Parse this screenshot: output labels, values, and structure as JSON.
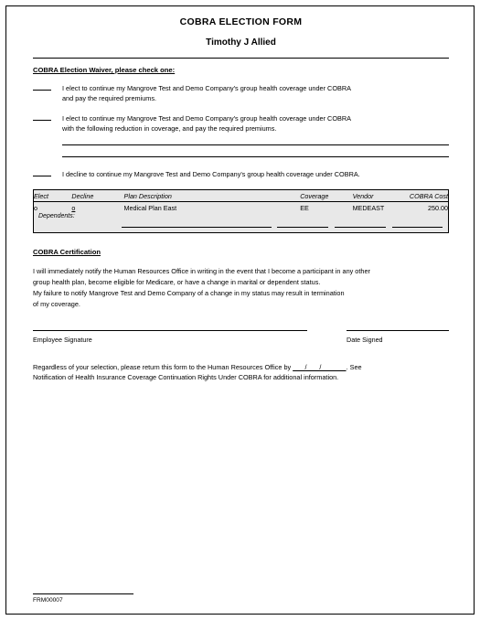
{
  "document": {
    "title": "COBRA ELECTION FORM",
    "employee_name": "Timothy J Allied"
  },
  "waiver": {
    "heading": "COBRA Election Waiver, please check one:",
    "options": [
      {
        "blank": "",
        "line1": "I elect to continue my Mangrove Test and Demo Company's group health coverage under COBRA",
        "line2": "and pay the required premiums."
      },
      {
        "blank": "",
        "line1": "I elect to continue my Mangrove Test and Demo Company's group health coverage under COBRA",
        "line2": "with the following reduction in coverage, and pay the required premiums."
      }
    ],
    "decline_option": {
      "blank": "",
      "text": "I decline to continue my Mangrove Test and Demo Company's group health coverage under COBRA."
    }
  },
  "plan_table": {
    "headers": {
      "elect": "Elect",
      "decline": "Decline",
      "plan_description": "Plan Description",
      "coverage": "Coverage",
      "vendor": "Vendor",
      "cobra_cost": "COBRA Cost"
    },
    "rows": [
      {
        "elect_marker": "o",
        "decline_marker": "o",
        "plan_description": "Medical Plan East",
        "coverage": "EE",
        "vendor": "MEDEAST",
        "cobra_cost": "250.00"
      }
    ],
    "dependents_label": "Dependents:"
  },
  "certification": {
    "heading": "COBRA Certification",
    "lines": [
      "I will immediately notify the Human Resources Office in writing in the event that I become a participant in any other",
      "group health plan, become eligible for Medicare, or have a change in marital or dependent status.",
      "My failure to notify Mangrove Test and Demo Company of a change in my status may result in termination",
      "of my coverage."
    ]
  },
  "signature": {
    "employee_label": "Employee Signature",
    "date_label": "Date Signed"
  },
  "closing": {
    "line1_before": "Regardless of your selection, please return this form to the Human Resources Office by ",
    "date_blank": "___/___/______",
    "line1_after": ". See",
    "line2": "Notification of Health Insurance Coverage Continuation Rights Under COBRA for additional information."
  },
  "footer": {
    "form_id": "FRM00007"
  }
}
